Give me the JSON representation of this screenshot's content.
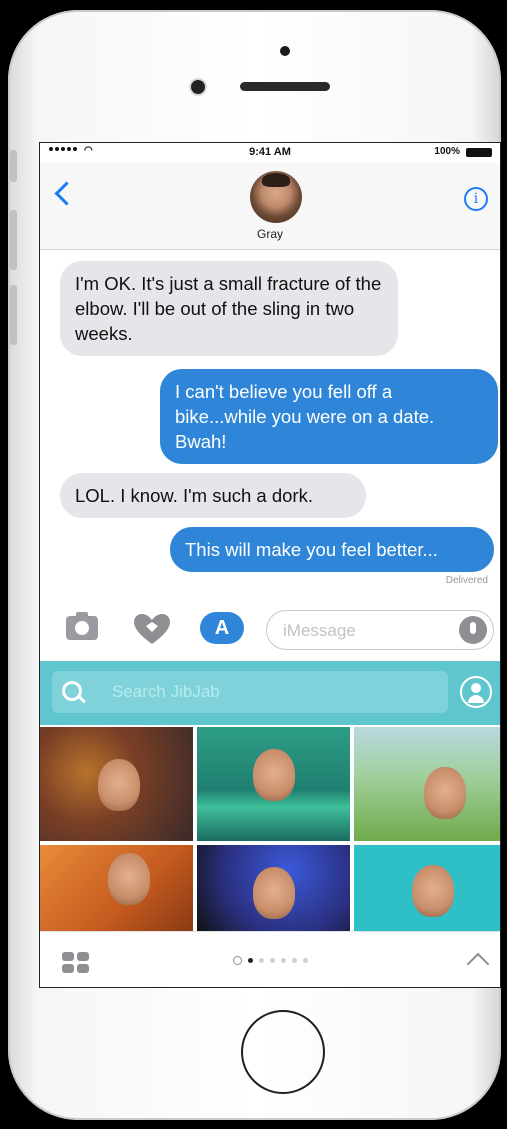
{
  "status_bar": {
    "time": "9:41 AM",
    "battery": "100%"
  },
  "conversation": {
    "contact_name": "Gray",
    "messages": [
      {
        "from": "received",
        "text": "I'm OK. It's just a small fracture of the elbow. I'll be out of the sling in two weeks."
      },
      {
        "from": "sent",
        "text": "I can't believe you fell off a bike...while you were on a date. Bwah!"
      },
      {
        "from": "received",
        "text": "LOL. I know. I'm such a dork."
      },
      {
        "from": "sent",
        "text": "This will make you feel better..."
      }
    ],
    "delivery_status": "Delivered"
  },
  "composer": {
    "placeholder": "iMessage"
  },
  "app_drawer": {
    "search_placeholder": "Search JibJab",
    "tiles": [
      "jibjab-card-1",
      "jibjab-card-2",
      "jibjab-card-3",
      "jibjab-card-4",
      "jibjab-card-5",
      "jibjab-card-6"
    ],
    "page_count": 6,
    "active_page": 1,
    "brand_color": "#5fc6cf"
  },
  "colors": {
    "sent_bubble": "#2f86d8",
    "received_bubble": "#e5e5ea",
    "ios_blue": "#1a7cf6"
  }
}
